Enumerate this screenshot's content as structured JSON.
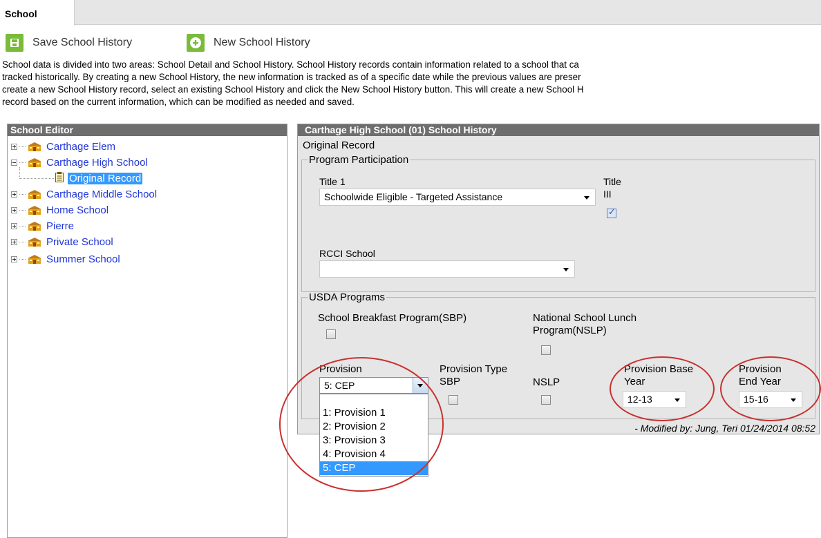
{
  "tab": {
    "label": "School"
  },
  "toolbar": {
    "save_label": "Save School History",
    "new_label": "New School History"
  },
  "intro": {
    "line1": "School data is divided into two areas: School Detail and School History. School History records contain information related to a school that ca",
    "line2": "tracked historically. By creating a new School History, the new information is tracked as of a specific date while the previous values are preser",
    "line3": "create a new School History record, select an existing School History and click the New School History button. This will create a new School H",
    "line4": "record based on the current information, which can be modified as needed and saved."
  },
  "editor": {
    "title": "School Editor",
    "items": [
      {
        "label": "Carthage Elem"
      },
      {
        "label": "Carthage High School"
      },
      {
        "label": "Original Record"
      },
      {
        "label": "Carthage Middle School"
      },
      {
        "label": "Home School"
      },
      {
        "label": "Pierre"
      },
      {
        "label": "Private School"
      },
      {
        "label": "Summer School"
      }
    ]
  },
  "history": {
    "title": "Carthage High School (01) School History",
    "record_label": "Original Record",
    "program": {
      "legend": "Program Participation",
      "title1_label": "Title 1",
      "title1_value": "Schoolwide Eligible - Targeted Assistance",
      "title3_label_a": "Title",
      "title3_label_b": "III",
      "title3_checked": true,
      "rcci_label": "RCCI School",
      "rcci_value": ""
    },
    "usda": {
      "legend": "USDA Programs",
      "sbp_label": "School Breakfast Program(SBP)",
      "nslp_label_a": "National School Lunch",
      "nslp_label_b": "Program(NSLP)",
      "provision_label": "Provision",
      "provision_value": "5: CEP",
      "ptype_label_a": "Provision Type",
      "ptype_label_b": "SBP",
      "ptype_nslp_label": "NSLP",
      "base_label_a": "Provision Base",
      "base_label_b": "Year",
      "base_value": "12-13",
      "end_label_a": "Provision",
      "end_label_b": "End Year",
      "end_value": "15-16"
    },
    "modified": "- Modified by: Jung, Teri 01/24/2014 08:52"
  },
  "provision_options": [
    "1: Provision 1",
    "2: Provision 2",
    "3: Provision 3",
    "4: Provision 4",
    "5: CEP"
  ],
  "colors": {
    "header_gray": "#6e6e6e",
    "link_blue": "#1f36d6",
    "selected_blue": "#3399ff",
    "annotation_red": "#c8312f",
    "button_green": "#7bbb3a"
  }
}
